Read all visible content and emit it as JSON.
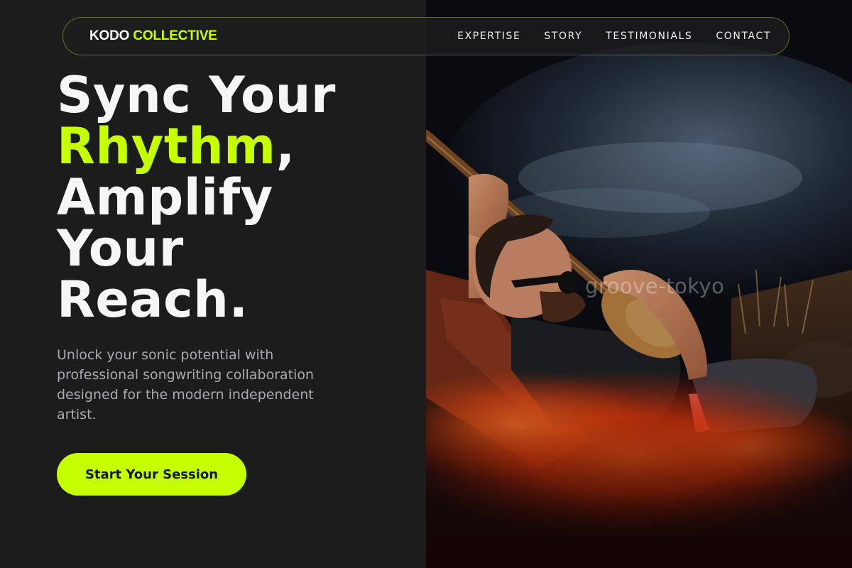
{
  "nav": {
    "logo_main": "KODO",
    "logo_accent": "COLLECTIVE",
    "links": [
      "EXPERTISE",
      "STORY",
      "TESTIMONIALS",
      "CONTACT"
    ]
  },
  "hero": {
    "headline": {
      "line1": "Sync Your",
      "line2_accent": "Rhythm",
      "line2_rest": ",",
      "line3": "Amplify",
      "line4": "Your",
      "line5": "Reach."
    },
    "description": "Unlock your sonic potential with professional songwriting collaboration designed for the modern independent artist.",
    "cta_label": "Start Your Session",
    "image_watermark": "groove-tokyo"
  },
  "colors": {
    "accent": "#c6ff00",
    "background": "#1c1c1c",
    "text_muted": "#a7abb1"
  }
}
